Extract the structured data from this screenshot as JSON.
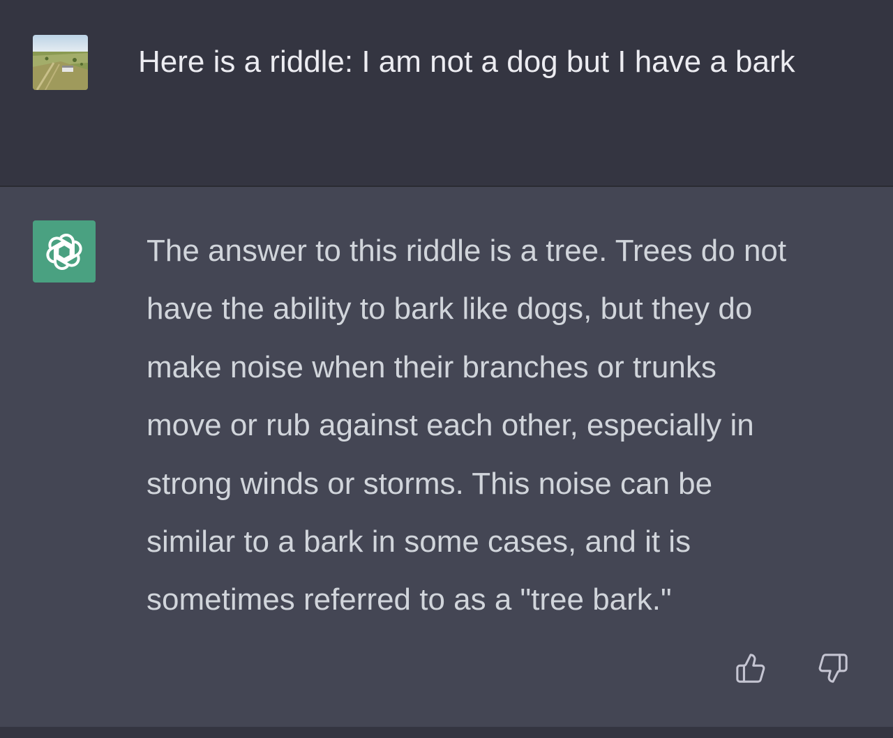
{
  "user_turn": {
    "avatar_icon": "user-avatar-landscape-photo",
    "message": "Here is a riddle: I am not a dog but I have a bark"
  },
  "assistant_turn": {
    "avatar_icon": "openai-logo-icon",
    "message_lines": [
      "The answer to this riddle is a tree. Trees do not",
      "have the ability to bark like dogs, but they do",
      "make noise when their branches or trunks",
      "move or rub against each other, especially in",
      "strong winds or storms. This noise can be",
      "similar to a bark in some cases, and it is",
      "sometimes referred to as a \"tree bark.\""
    ],
    "feedback_icons": [
      "thumbs-up-icon",
      "thumbs-down-icon"
    ]
  },
  "colors": {
    "user_bg": "#343541",
    "assistant_bg": "#444654",
    "assistant_avatar_bg": "#4aa181",
    "user_text": "#ececf1",
    "assistant_text": "#d1d5db",
    "icon_color": "#c5c5d2"
  }
}
